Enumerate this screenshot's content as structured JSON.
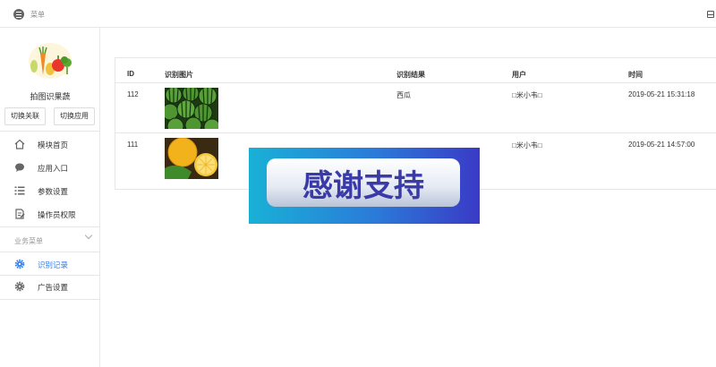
{
  "header": {
    "menu_label": "菜单",
    "menu_icon": "list-circle-icon",
    "right_icon": "window-icon"
  },
  "sidebar": {
    "app_name": "拍图识果蔬",
    "buttons": [
      "切换关联",
      "切换应用"
    ],
    "items": [
      {
        "label": "模块首页",
        "icon": "home-icon"
      },
      {
        "label": "应用入口",
        "icon": "chat-icon"
      },
      {
        "label": "参数设置",
        "icon": "list-settings-icon"
      },
      {
        "label": "操作员权限",
        "icon": "document-edit-icon"
      }
    ],
    "group": {
      "label": "业务菜单"
    },
    "group_items": [
      {
        "label": "识别记录",
        "icon": "gear-icon",
        "active": true
      },
      {
        "label": "广告设置",
        "icon": "gear-icon"
      }
    ]
  },
  "table": {
    "columns": [
      "ID",
      "识别图片",
      "识别结果",
      "用户",
      "时间"
    ],
    "rows": [
      {
        "id": "112",
        "result": "西瓜",
        "user": "□米小韦□",
        "time": "2019-05-21 15:31:18",
        "image": "watermelon-photo"
      },
      {
        "id": "111",
        "result": "",
        "user": "□米小韦□",
        "time": "2019-05-21 14:57:00",
        "image": "orange-photo"
      }
    ]
  },
  "overlay": {
    "text": "感谢支持"
  },
  "colors": {
    "accent": "#2f7ff0",
    "banner_left": "#1aa8d8",
    "banner_right": "#3a3ec8"
  }
}
